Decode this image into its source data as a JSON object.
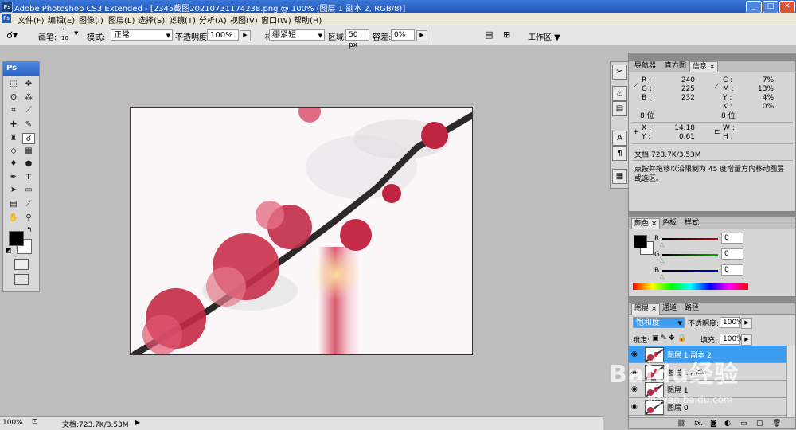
{
  "window": {
    "title": "Adobe Photoshop CS3 Extended - [2345截图20210731174238.png @ 100% (图层 1 副本 2, RGB/8)]",
    "logo": "Ps"
  },
  "menu": [
    "文件(F)",
    "编辑(E)",
    "图像(I)",
    "图层(L)",
    "选择(S)",
    "滤镜(T)",
    "分析(A)",
    "视图(V)",
    "窗口(W)",
    "帮助(H)"
  ],
  "options": {
    "brush_label": "画笔:",
    "brush_size": "10",
    "mode_label": "模式:",
    "mode_value": "正常",
    "opacity_label": "不透明度:",
    "opacity_value": "100%",
    "style_label": "样式:",
    "style_value": "绷紧短",
    "area_label": "区域:",
    "area_value": "50 px",
    "tolerance_label": "容差:",
    "tolerance_value": "0%",
    "workspace_label": "工作区"
  },
  "toolbox": {
    "header": "Ps"
  },
  "status": {
    "zoom": "100%",
    "doc": "文档:723.7K/3.53M"
  },
  "info_panel": {
    "tabs": [
      "导航器",
      "直方图",
      "信息"
    ],
    "R": "240",
    "G": "225",
    "B": "232",
    "C": "7%",
    "M": "13%",
    "Y": "4%",
    "K": "0%",
    "bits_left": "8 位",
    "bits_right": "8 位",
    "X": "14.18",
    "Ycoord": "0.61",
    "W": "",
    "H": "",
    "doc": "文档:723.7K/3.53M",
    "hint": "点按并拖移以沿限制为 45 度增量方向移动图层或选区。"
  },
  "color_panel": {
    "tabs": [
      "颜色",
      "色板",
      "样式"
    ],
    "R_label": "R",
    "G_label": "G",
    "B_label": "B",
    "R": "0",
    "G": "0",
    "B": "0"
  },
  "layers_panel": {
    "tabs": [
      "图层",
      "通道",
      "路径"
    ],
    "blend": "饱和度",
    "opacity_label": "不透明度:",
    "opacity": "100%",
    "lock_label": "锁定:",
    "fill_label": "填充:",
    "fill": "100%",
    "layers": [
      {
        "name": "图层 1 副本 2",
        "selected": true
      },
      {
        "name": "图层 1 副本",
        "selected": false
      },
      {
        "name": "图层 1",
        "selected": false
      },
      {
        "name": "图层 0",
        "selected": false
      }
    ]
  },
  "watermark": {
    "brand": "Baidu经验",
    "url": "jingyan.baidu.com"
  },
  "colors": {
    "accent": "#3c9cf0",
    "titlebar": "#245fc0",
    "selected_layer": "#3c9cf0"
  }
}
